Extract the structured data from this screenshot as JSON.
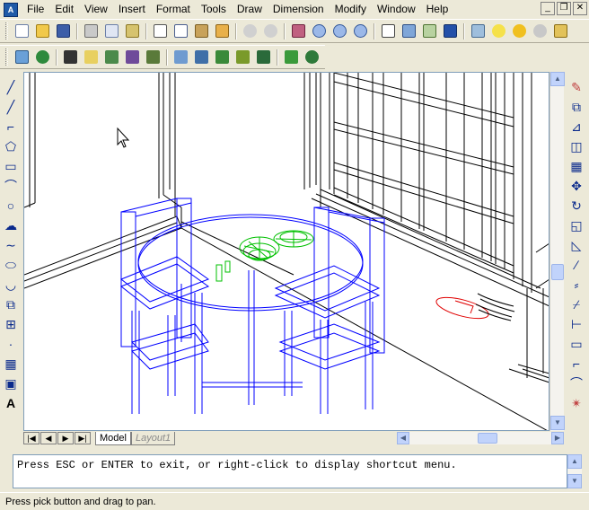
{
  "app": {
    "icon_label": "A"
  },
  "menubar": {
    "items": [
      "File",
      "Edit",
      "View",
      "Insert",
      "Format",
      "Tools",
      "Draw",
      "Dimension",
      "Modify",
      "Window",
      "Help"
    ]
  },
  "window_controls": {
    "minimize": "_",
    "restore": "❐",
    "close": "✕"
  },
  "toolbar_standard": {
    "icons": [
      "new-icon",
      "open-icon",
      "save-icon",
      "print-icon",
      "plot-preview-icon",
      "publish-icon",
      "cut-icon",
      "copy-icon",
      "paste-icon",
      "match-properties-icon",
      "undo-icon",
      "redo-icon",
      "pan-icon",
      "zoom-realtime-icon",
      "zoom-window-icon",
      "zoom-previous-icon",
      "properties-icon",
      "design-center-icon",
      "help-icon",
      "layers-icon",
      "bulb-icon",
      "sun-icon",
      "freeze-icon",
      "lock-icon"
    ]
  },
  "toolbar_render": {
    "icons": [
      "hide-icon",
      "render-icon",
      "scenes-icon",
      "lights-icon",
      "materials-icon",
      "materials-library-icon",
      "mapping-icon",
      "background-icon",
      "fog-icon",
      "landscape-new-icon",
      "landscape-edit-icon",
      "landscape-library-icon",
      "render-prefs-icon",
      "statistics-icon"
    ]
  },
  "draw_toolbar": {
    "icons": [
      "line-icon",
      "construction-line-icon",
      "polyline-icon",
      "polygon-icon",
      "rectangle-icon",
      "arc-icon",
      "circle-icon",
      "revision-cloud-icon",
      "spline-icon",
      "ellipse-icon",
      "ellipse-arc-icon",
      "insert-block-icon",
      "make-block-icon",
      "point-icon",
      "hatch-icon",
      "region-icon",
      "multiline-text-icon"
    ]
  },
  "draw_toolbar_glyphs": [
    "╱",
    "╱",
    "⌐",
    "⬠",
    "▭",
    "⌒",
    "○",
    "☁",
    "∼",
    "⬭",
    "◡",
    "⧉",
    "⊞",
    "·",
    "▦",
    "▣",
    "A"
  ],
  "modify_toolbar": {
    "icons": [
      "erase-icon",
      "copy-object-icon",
      "mirror-icon",
      "offset-icon",
      "array-icon",
      "move-icon",
      "rotate-icon",
      "scale-icon",
      "stretch-icon",
      "trim-icon",
      "extend-icon",
      "break-at-point-icon",
      "break-icon",
      "join-icon",
      "chamfer-icon",
      "fillet-icon",
      "explode-icon"
    ]
  },
  "modify_toolbar_glyphs": [
    "✎",
    "⧉",
    "⊿",
    "◫",
    "▦",
    "✥",
    "↻",
    "◱",
    "◺",
    "∕",
    "⸗",
    "⌿",
    "⊢",
    "▭",
    "⌐",
    "⌒",
    "✴"
  ],
  "tabs": {
    "nav": [
      "|◀",
      "◀",
      "▶",
      "▶|"
    ],
    "model": "Model",
    "layout": "Layout1"
  },
  "command_line": {
    "text": "Press ESC or ENTER to exit, or right-click to display shortcut menu."
  },
  "status_bar": {
    "text": "Press pick button and drag to pan."
  },
  "colors": {
    "wireframe_furniture": "#0000ff",
    "wireframe_room": "#000000",
    "wireframe_green": "#00d000",
    "wireframe_red": "#e00000"
  }
}
